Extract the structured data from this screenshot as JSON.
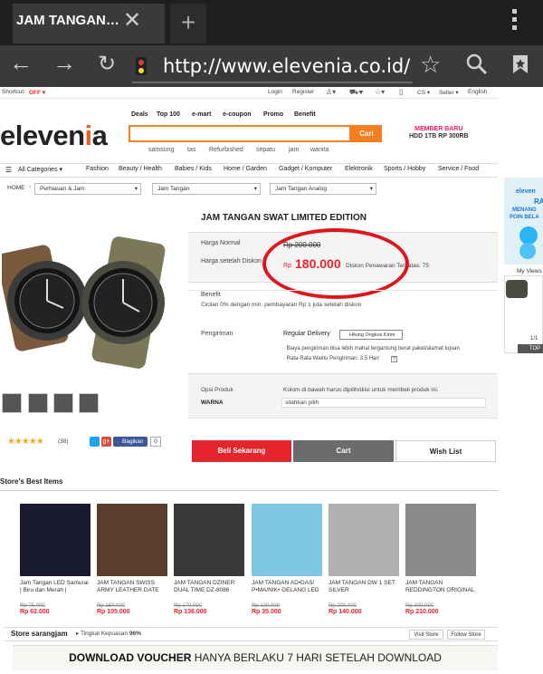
{
  "browser": {
    "tab_title": "JAM TANGAN…",
    "close_glyph": "✕",
    "newtab_glyph": "+",
    "url": "http://www.elevenia.co.id/prd-j",
    "back_glyph": "←",
    "forward_glyph": "→",
    "reload_glyph": "↻",
    "star_glyph": "☆",
    "search_glyph": "⚲"
  },
  "topbar": {
    "shortcut": "Shortcut:",
    "shortcut_state": "OFF ▾",
    "login": "Login",
    "register": "Register",
    "cs": "CS ▾",
    "seller": "Seller ▾",
    "language": "English"
  },
  "header": {
    "logo_prefix": "eleven",
    "logo_i": "i",
    "logo_suffix": "a",
    "menu": [
      "Deals",
      "Top 100",
      "e-mart",
      "e-coupon",
      "Promo",
      "Benefit"
    ],
    "search_button": "Cari",
    "keywords": [
      "samsung",
      "tas",
      "Refurbished",
      "sepatu",
      "jam",
      "wanita"
    ],
    "promo_line1": "MEMBER BARU",
    "promo_line2": "HDD 1TB RP 300RB"
  },
  "categories": {
    "all": "All Categories ▾",
    "items": [
      "Fashion",
      "Beauty / Health",
      "Babies / Kids",
      "Home / Garden",
      "Gadget / Komputer",
      "Elektronik",
      "Sports / Hobby",
      "Service / Food"
    ]
  },
  "breadcrumb": {
    "home": "HOME",
    "level1": "Perhiasan & Jam",
    "level2": "Jam Tangan",
    "level3": "Jam Tangan Analog"
  },
  "product": {
    "title": "JAM TANGAN SWAT LIMITED EDITION",
    "normal_label": "Harga Normal",
    "normal_price": "Rp 200.000",
    "after_label": "Harga setelah Diskon",
    "currency": "Rp",
    "price": "180.000",
    "discount_text": "Diskon Penawaran Terbatas: 75",
    "benefit_label": "Benefit",
    "benefit_text": "Cicilan 0% dengan min. pembayaran Rp 1 juta setelah diskon",
    "shipping_label": "Pengiriman",
    "shipping_type": "Regular Delivery",
    "shipping_calc": "Hitung Ongkos Kirim",
    "shipping_note1": "· Biaya pengiriman bisa lebih mahal tergantung berat paket/alamat tujuan",
    "shipping_note2": "· Rata-Rata Waktu Pengiriman: 3.5 Hari",
    "option_label": "Opsi Produk",
    "option_note": "Kolom di bawah harus dipilih/diisi untuk membeli produk ini.",
    "color_label": "WARNA",
    "color_placeholder": "silahkan pilih",
    "rating_count": "(38)",
    "share_label": "Bagikan",
    "share_count": "0",
    "buy_now": "Beli Sekarang",
    "cart": "Cart",
    "wishlist": "Wish List"
  },
  "side_ad": {
    "line1": "eleven",
    "line2": "RAC",
    "line3": "MENANG",
    "line4": "POIN BELA",
    "my_views": "My Views",
    "pager": "1/1",
    "top": "TOP"
  },
  "store": {
    "heading": "Store's Best Items",
    "items": [
      {
        "name": "Jam Tangan LED Samurai | Biru dan Merah |",
        "old": "Rp 75.000",
        "price": "Rp 62.000"
      },
      {
        "name": "JAM TANGAN SWISS ARMY LEATHER DATE",
        "old": "Rp 150.000",
        "price": "Rp 105.000"
      },
      {
        "name": "JAM TANGAN DZINER DUAL TIME DZ-8086",
        "old": "Rp 170.000",
        "price": "Rp 136.000"
      },
      {
        "name": "JAM TANGAN AD•DAS/ P•MA/NIK• GELANG LED",
        "old": "Rp 100.000",
        "price": "Rp 35.000"
      },
      {
        "name": "JAM TANGAN DW 1 SET SILVER",
        "old": "Rp 200.000",
        "price": "Rp 140.000"
      },
      {
        "name": "JAM TANGAN REDDINGTON ORIGINAL",
        "old": "Rp 300.000",
        "price": "Rp 210.000"
      }
    ],
    "footer_label": "Store sarangjam",
    "satisfaction_label": "Tingkat Kepuasan",
    "satisfaction_value": "96%",
    "visit_store": "Visit Store",
    "follow_store": "Follow Store"
  },
  "voucher": {
    "bold": "DOWNLOAD VOUCHER",
    "rest": "HANYA BERLAKU 7 HARI SETELAH DOWNLOAD"
  },
  "colors": {
    "brand_orange": "#f57f20",
    "price_red": "#e6242b",
    "annotation_red": "#e0141b",
    "cart_grey": "#6b6b6b"
  }
}
